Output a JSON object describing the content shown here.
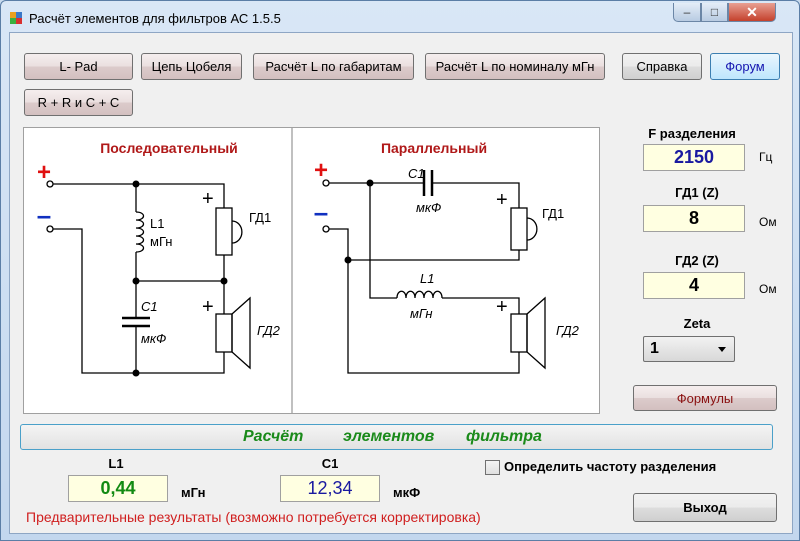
{
  "window": {
    "title": "Расчёт элементов для фильтров АС 1.5.5",
    "minimize": "–",
    "maximize": "□",
    "close": "✕"
  },
  "buttons": {
    "lpad": "L- Pad",
    "zobel": "Цепь Цобеля",
    "l_by_dims": "Расчёт L по габаритам",
    "l_by_nominal": "Расчёт L по номиналу мГн",
    "help": "Справка",
    "forum": "Форум",
    "rrcc": "R + R и C + C",
    "formulas": "Формулы",
    "exit": "Выход"
  },
  "diagram": {
    "series_title": "Последовательный",
    "parallel_title": "Параллельный",
    "plus": "+",
    "minus": "–",
    "series": {
      "l1": "L1",
      "l1_unit": "мГн",
      "c1": "С1",
      "c1_unit": "мкФ",
      "gd1": "ГД1",
      "gd2": "ГД2"
    },
    "parallel": {
      "c1": "С1",
      "c1_unit": "мкФ",
      "l1": "L1",
      "l1_unit": "мГн",
      "gd1": "ГД1",
      "gd2": "ГД2"
    }
  },
  "params": {
    "freq_label": "F разделения",
    "freq_value": "2150",
    "freq_unit": "Гц",
    "gd1_label": "ГД1 (Z)",
    "gd1_value": "8",
    "gd1_unit": "Ом",
    "gd2_label": "ГД2 (Z)",
    "gd2_value": "4",
    "gd2_unit": "Ом",
    "zeta_label": "Zeta",
    "zeta_value": "1"
  },
  "banner": {
    "word1": "Расчёт",
    "word2": "элементов",
    "word3": "фильтра"
  },
  "results": {
    "l1_label": "L1",
    "l1_value": "0,44",
    "l1_unit": "мГн",
    "c1_label": "С1",
    "c1_value": "12,34",
    "c1_unit": "мкФ"
  },
  "checkbox_label": "Определить частоту разделения",
  "note": "Предварительные результаты (возможно потребуется корректировка)",
  "colors": {
    "plus": "#e01010",
    "minus": "#1030c0",
    "title_red": "#b01818",
    "banner_green": "#1a8a1a",
    "value_blue": "#1a1aa0",
    "value_green": "#128a12",
    "note_red": "#d01f1f"
  }
}
